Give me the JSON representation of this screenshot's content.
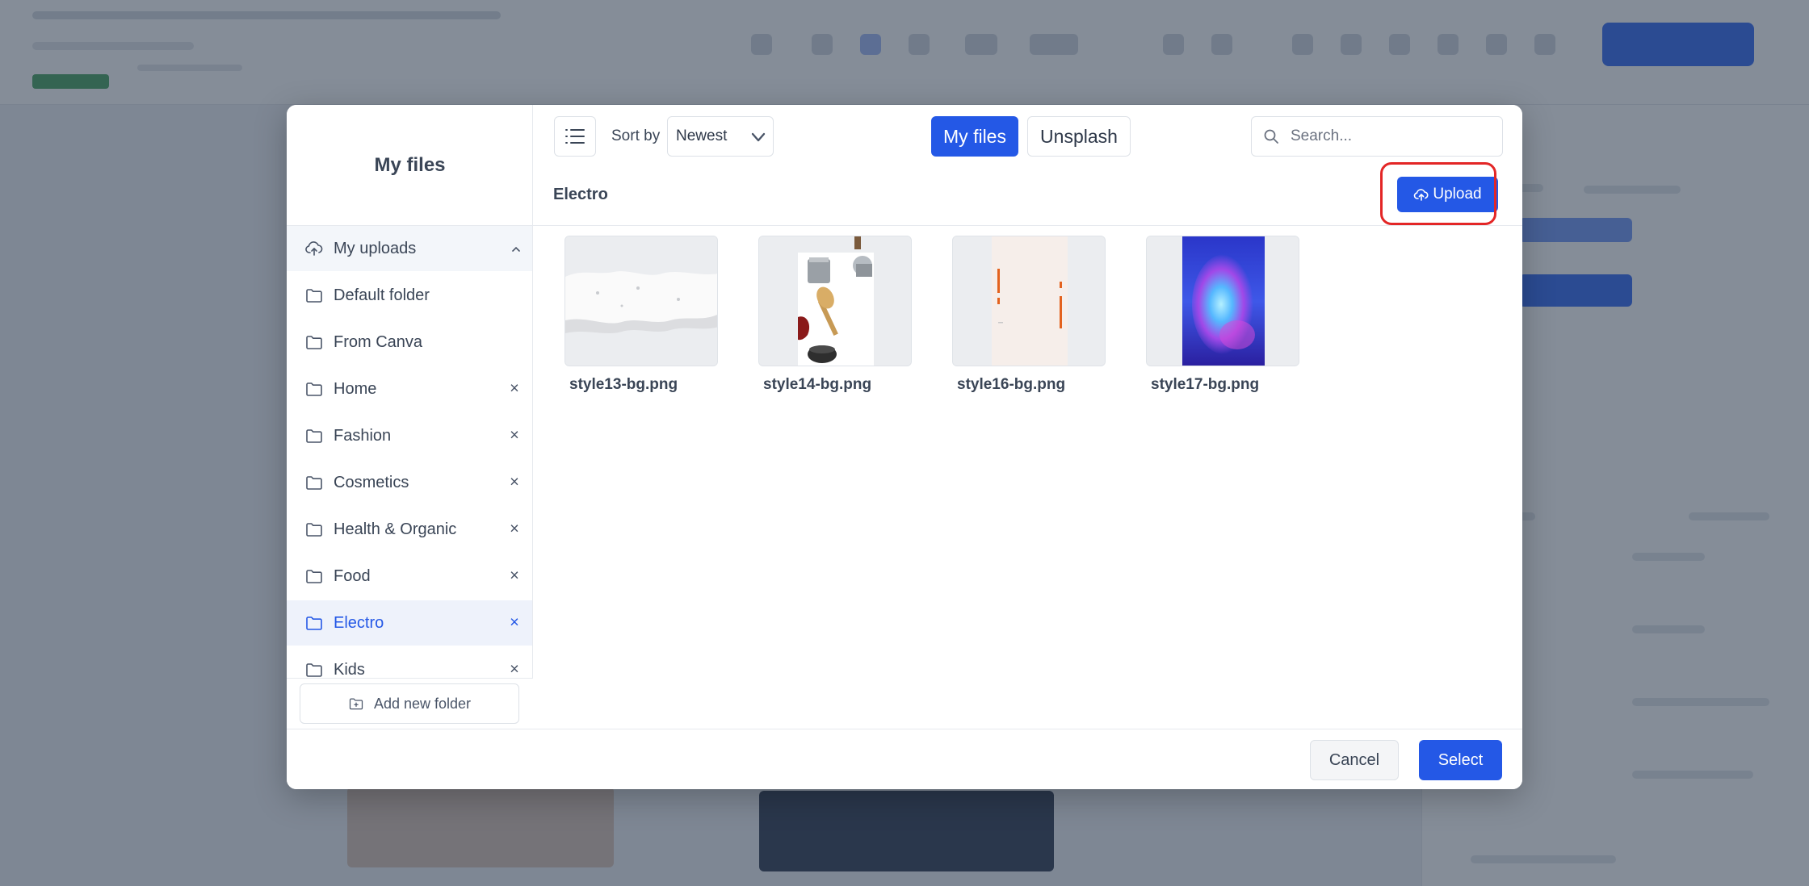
{
  "modal": {
    "title": "My files"
  },
  "sidebar": {
    "folders": [
      {
        "label": "My uploads",
        "icon": "cloud-upload-icon",
        "expanded": true
      },
      {
        "label": "Default folder",
        "icon": "folder-icon",
        "removable": false
      },
      {
        "label": "From Canva",
        "icon": "folder-icon",
        "removable": false
      },
      {
        "label": "Home",
        "icon": "folder-icon",
        "removable": true
      },
      {
        "label": "Fashion",
        "icon": "folder-icon",
        "removable": true
      },
      {
        "label": "Cosmetics",
        "icon": "folder-icon",
        "removable": true
      },
      {
        "label": "Health & Organic",
        "icon": "folder-icon",
        "removable": true
      },
      {
        "label": "Food",
        "icon": "folder-icon",
        "removable": true
      },
      {
        "label": "Electro",
        "icon": "folder-icon",
        "removable": true,
        "active": true
      },
      {
        "label": "Kids",
        "icon": "folder-icon",
        "removable": true
      }
    ],
    "remove_glyph": "×",
    "add_folder_label": "Add new folder"
  },
  "toolbar": {
    "sort_label": "Sort by",
    "sort_value": "Newest",
    "tabs": [
      {
        "label": "My files",
        "active": true
      },
      {
        "label": "Unsplash",
        "active": false
      }
    ],
    "search_placeholder": "Search...",
    "breadcrumb": "Electro",
    "upload_label": "Upload"
  },
  "files": [
    {
      "name": "style13-bg.png"
    },
    {
      "name": "style14-bg.png"
    },
    {
      "name": "style16-bg.png"
    },
    {
      "name": "style17-bg.png"
    }
  ],
  "footer": {
    "cancel_label": "Cancel",
    "select_label": "Select"
  },
  "colors": {
    "accent": "#2458e6",
    "highlight": "#e32626",
    "overlay": "#2d3a4e"
  }
}
